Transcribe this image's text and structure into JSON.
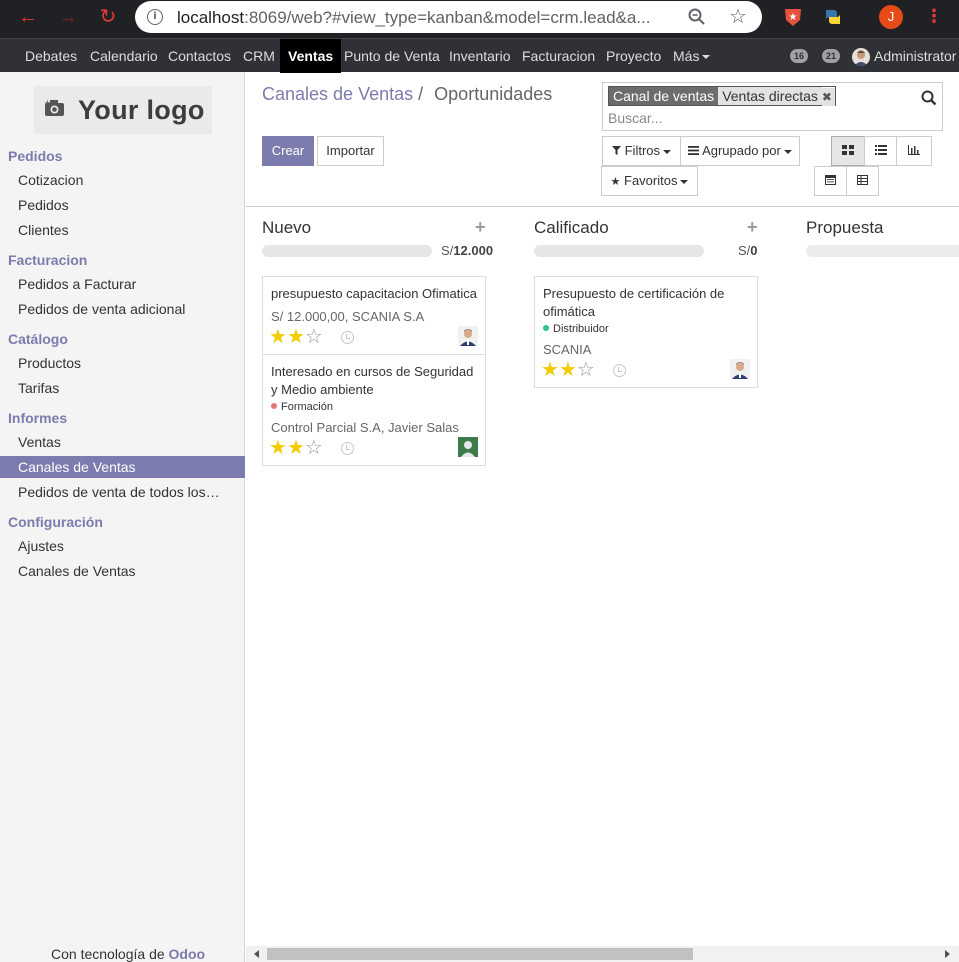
{
  "browser": {
    "url_host": "localhost",
    "url_rest": ":8069/web?#view_type=kanban&model=crm.lead&a...",
    "profile_initial": "J"
  },
  "topnav": {
    "items": [
      "Debates",
      "Calendario",
      "Contactos",
      "CRM",
      "Ventas",
      "Punto de Venta",
      "Inventario",
      "Facturacion",
      "Proyecto",
      "Más"
    ],
    "active": "Ventas",
    "badge_activities": "16",
    "badge_messages": "21",
    "user": "Administrator"
  },
  "sidebar": {
    "logo_text": "Your logo",
    "sections": [
      {
        "title": "Pedidos",
        "items": [
          "Cotizacion",
          "Pedidos",
          "Clientes"
        ]
      },
      {
        "title": "Facturacion",
        "items": [
          "Pedidos a Facturar",
          "Pedidos de venta adicional"
        ]
      },
      {
        "title": "Catálogo",
        "items": [
          "Productos",
          "Tarifas"
        ]
      },
      {
        "title": "Informes",
        "items": [
          "Ventas",
          "Canales de Ventas",
          "Pedidos de venta de todos los…"
        ]
      },
      {
        "title": "Configuración",
        "items": [
          "Ajustes",
          "Canales de Ventas"
        ]
      }
    ],
    "active_item": "Canales de Ventas",
    "powered_prefix": "Con tecnología de",
    "powered_brand": "Odoo"
  },
  "breadcrumb": {
    "parent": "Canales de Ventas",
    "separator": "/",
    "current": "Oportunidades"
  },
  "search": {
    "facet_label": "Canal de ventas",
    "facet_value": "Ventas directas",
    "placeholder": "Buscar..."
  },
  "buttons": {
    "create": "Crear",
    "import": "Importar",
    "filters": "Filtros",
    "group_by": "Agrupado por",
    "favorites": "Favoritos"
  },
  "kanban": {
    "columns": [
      {
        "name": "Nuevo",
        "total_prefix": "S/",
        "total": "12.000",
        "cards": [
          {
            "title": "presupuesto capacitacion Ofimatica",
            "meta": "S/ 12.000,00, SCANIA S.A",
            "tag": "",
            "stars": 2
          },
          {
            "title": "Interesado en cursos de Seguridad y Medio ambiente",
            "meta": "Control Parcial S.A, Javier Salas",
            "tag": "Formación",
            "tag_color": "#e17878",
            "stars": 2
          }
        ]
      },
      {
        "name": "Calificado",
        "total_prefix": "S/",
        "total": "0",
        "cards": [
          {
            "title": "Presupuesto de certificación de ofimática",
            "meta": "SCANIA",
            "tag": "Distribuidor",
            "tag_color": "#30c381",
            "stars": 2
          }
        ]
      },
      {
        "name": "Propuesta",
        "cards": []
      }
    ]
  },
  "colors": {
    "accent": "#7c7bad",
    "star_on": "#f3cc00"
  }
}
